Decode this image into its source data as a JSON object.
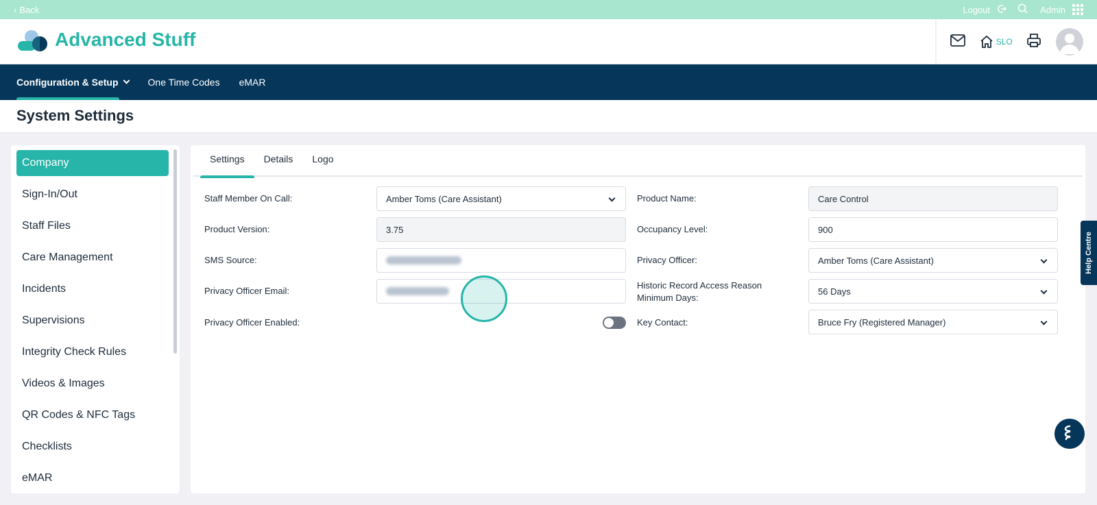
{
  "topbar": {
    "back": "Back",
    "logout": "Logout",
    "admin": "Admin"
  },
  "header": {
    "brand": "Advanced Stuff",
    "location": "SLO"
  },
  "nav": [
    {
      "label": "Configuration & Setup"
    },
    {
      "label": "One Time Codes"
    },
    {
      "label": "eMAR"
    }
  ],
  "page": {
    "title": "System Settings"
  },
  "sidebar": {
    "items": [
      {
        "label": "Company"
      },
      {
        "label": "Sign-In/Out"
      },
      {
        "label": "Staff Files"
      },
      {
        "label": "Care Management"
      },
      {
        "label": "Incidents"
      },
      {
        "label": "Supervisions"
      },
      {
        "label": "Integrity Check Rules"
      },
      {
        "label": "Videos & Images"
      },
      {
        "label": "QR Codes & NFC Tags"
      },
      {
        "label": "Checklists"
      },
      {
        "label": "eMAR"
      }
    ]
  },
  "tabs": [
    {
      "label": "Settings"
    },
    {
      "label": "Details"
    },
    {
      "label": "Logo"
    }
  ],
  "form": {
    "staff_on_call": {
      "label": "Staff Member On Call:",
      "value": "Amber Toms (Care Assistant)"
    },
    "product_version": {
      "label": "Product Version:",
      "value": "3.75"
    },
    "sms_source": {
      "label": "SMS Source:",
      "value": ""
    },
    "privacy_officer_email": {
      "label": "Privacy Officer Email:",
      "value": ""
    },
    "privacy_officer_enabled": {
      "label": "Privacy Officer Enabled:",
      "value": false
    },
    "product_name": {
      "label": "Product Name:",
      "value": "Care Control"
    },
    "occupancy_level": {
      "label": "Occupancy Level:",
      "value": "900"
    },
    "privacy_officer": {
      "label": "Privacy Officer:",
      "value": "Amber Toms (Care Assistant)"
    },
    "historic_record": {
      "label_line1": "Historic Record Access Reason",
      "label_line2": "Minimum Days:",
      "value": "56 Days"
    },
    "key_contact": {
      "label": "Key Contact:",
      "value": "Bruce Fry (Registered Manager)"
    }
  },
  "help": {
    "label": "Help Centre"
  },
  "colors": {
    "accent": "#26b5a8",
    "navy": "#06365a",
    "topbar": "#a8e6cf"
  }
}
